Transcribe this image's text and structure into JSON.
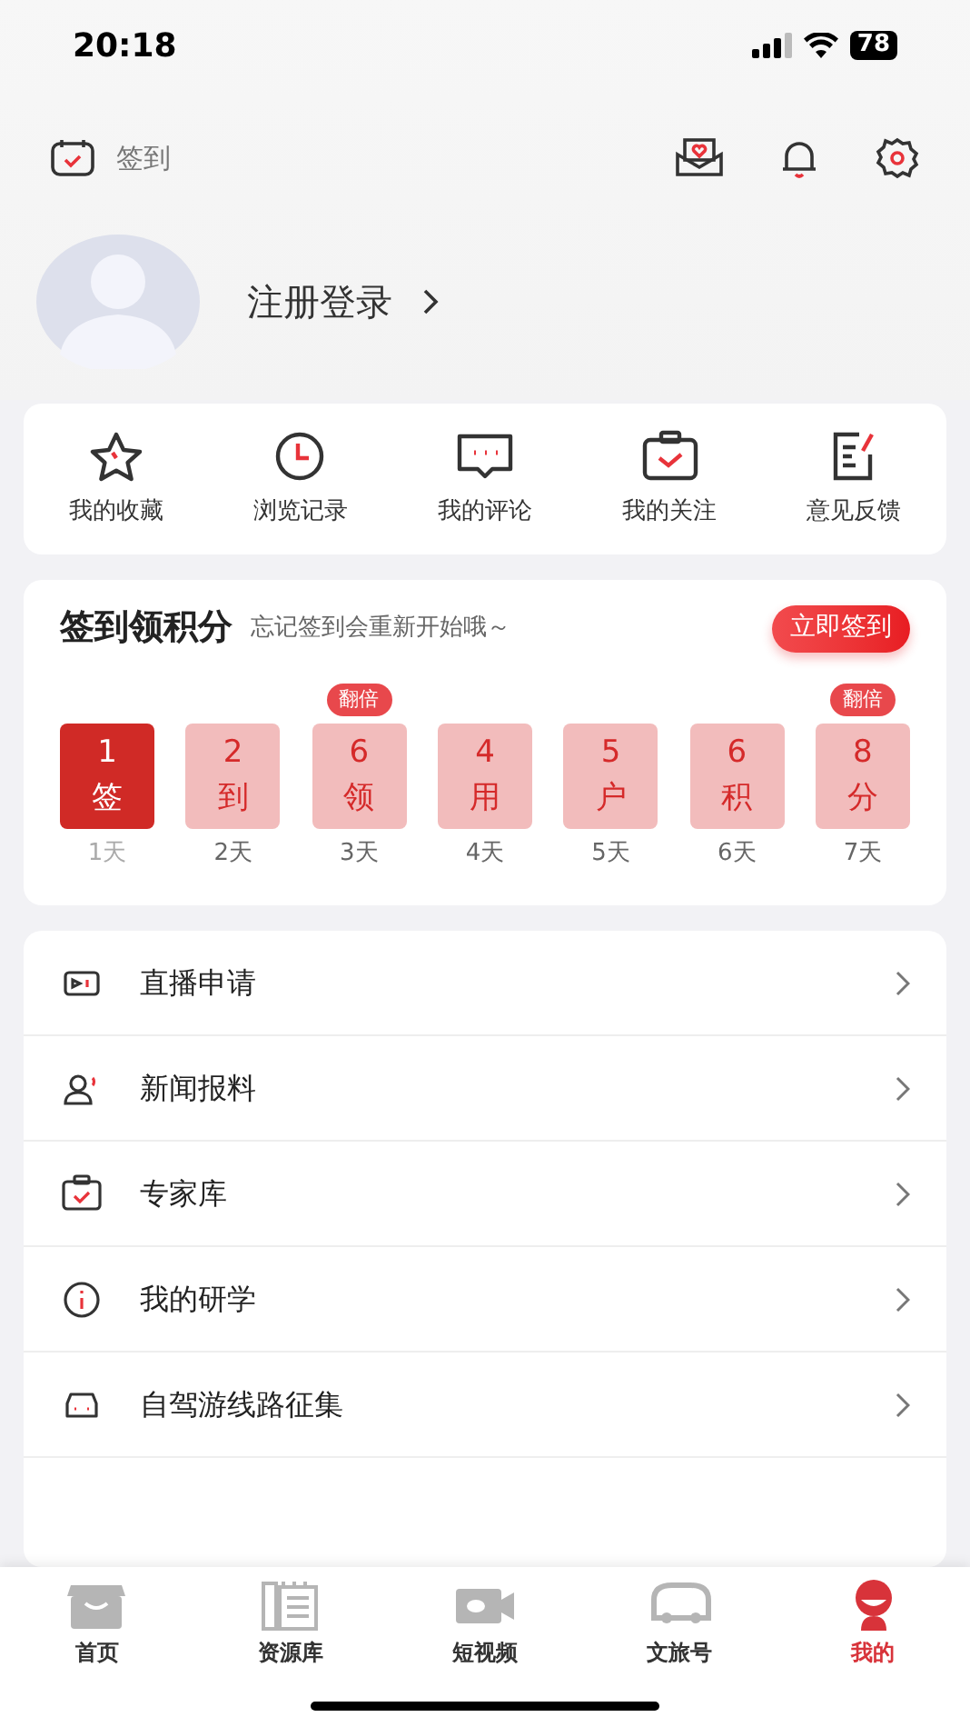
{
  "status_bar": {
    "time": "20:18",
    "battery": "78"
  },
  "header": {
    "checkin_label": "签到"
  },
  "profile": {
    "login_label": "注册登录"
  },
  "quick_actions": [
    {
      "label": "我的收藏"
    },
    {
      "label": "浏览记录"
    },
    {
      "label": "我的评论"
    },
    {
      "label": "我的关注"
    },
    {
      "label": "意见反馈"
    }
  ],
  "checkin": {
    "title": "签到领积分",
    "subtitle": "忘记签到会重新开始哦～",
    "button": "立即签到",
    "days": [
      {
        "points": "1",
        "char": "签",
        "day": "1天",
        "selected": true
      },
      {
        "points": "2",
        "char": "到",
        "day": "2天",
        "selected": false
      },
      {
        "points": "6",
        "char": "领",
        "day": "3天",
        "selected": false,
        "badge": "翻倍"
      },
      {
        "points": "4",
        "char": "用",
        "day": "4天",
        "selected": false
      },
      {
        "points": "5",
        "char": "户",
        "day": "5天",
        "selected": false
      },
      {
        "points": "6",
        "char": "积",
        "day": "6天",
        "selected": false
      },
      {
        "points": "8",
        "char": "分",
        "day": "7天",
        "selected": false,
        "badge": "翻倍"
      }
    ]
  },
  "menu": [
    {
      "label": "直播申请"
    },
    {
      "label": "新闻报料"
    },
    {
      "label": "专家库"
    },
    {
      "label": "我的研学"
    },
    {
      "label": "自驾游线路征集"
    }
  ],
  "tab_bar": [
    {
      "label": "首页",
      "selected": false
    },
    {
      "label": "资源库",
      "selected": false
    },
    {
      "label": "短视频",
      "selected": false
    },
    {
      "label": "文旅号",
      "selected": false
    },
    {
      "label": "我的",
      "selected": true
    }
  ]
}
